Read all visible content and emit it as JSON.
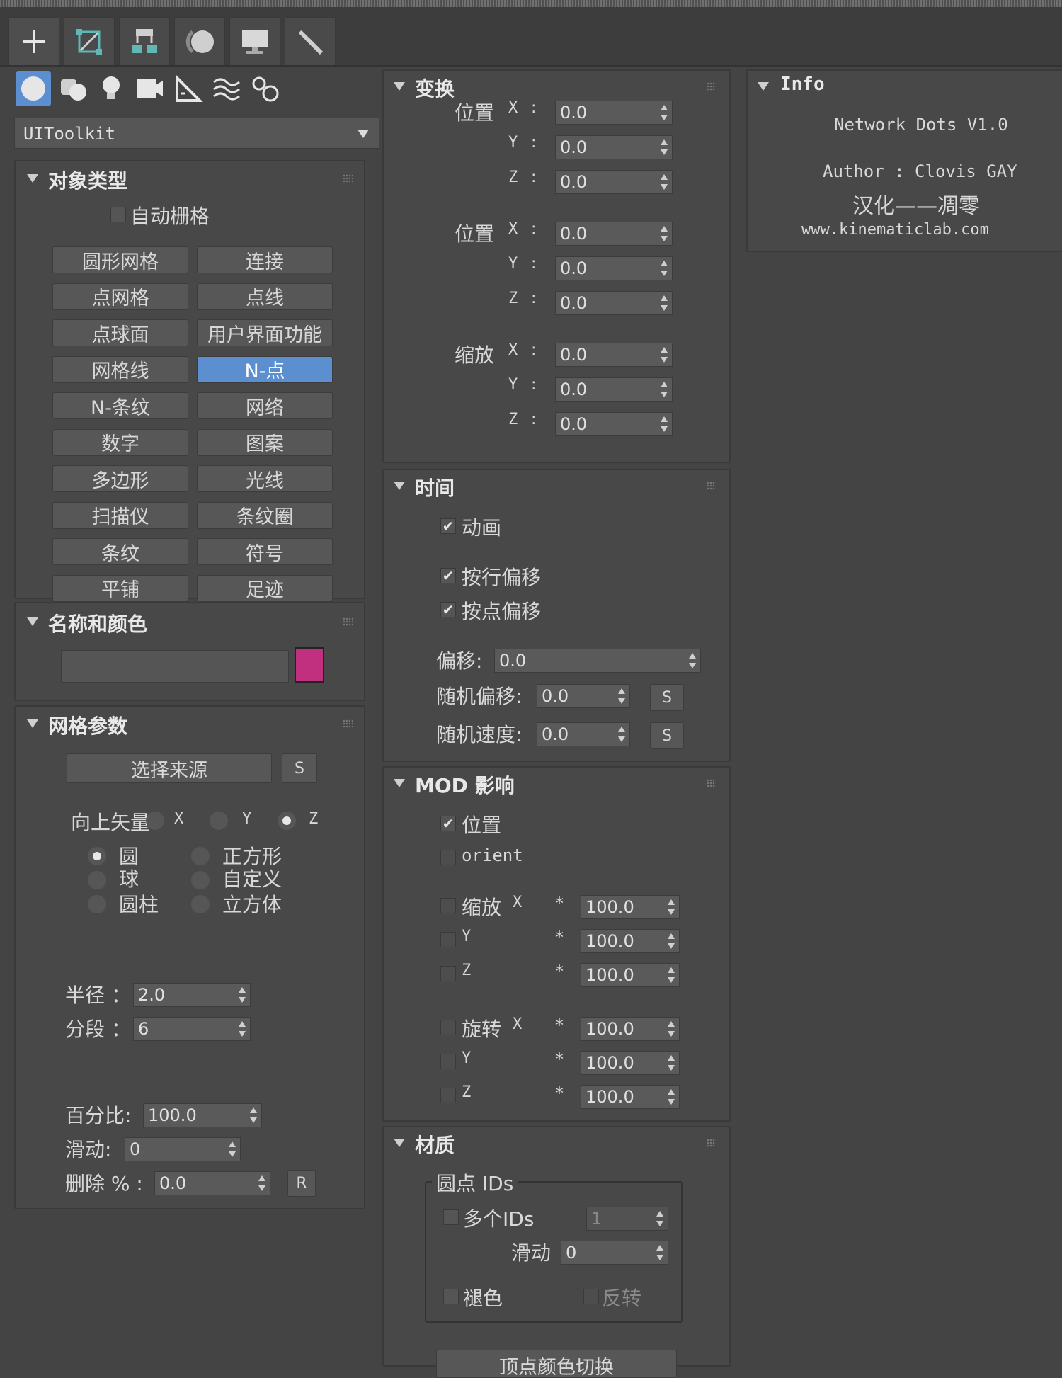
{
  "tabs": [
    "create-icon",
    "modify-icon",
    "hierarchy-icon",
    "motion-icon",
    "display-icon",
    "utilities-icon"
  ],
  "category_icons": [
    "geometry-icon",
    "shapes-icon",
    "lights-icon",
    "cameras-icon",
    "helpers-icon",
    "spacewarps-icon",
    "systems-icon"
  ],
  "dropdown": {
    "value": "UIToolkit"
  },
  "object_type": {
    "title": "对象类型",
    "autogrid": "自动栅格",
    "buttons": [
      "圆形网格",
      "连接",
      "点网格",
      "点线",
      "点球面",
      "用户界面功能",
      "网格线",
      "N-点",
      "N-条纹",
      "网络",
      "数字",
      "图案",
      "多边形",
      "光线",
      "扫描仪",
      "条纹圈",
      "条纹",
      "符号",
      "平铺",
      "足迹"
    ],
    "selected": "N-点"
  },
  "name_color": {
    "title": "名称和颜色",
    "name_value": "",
    "color": "#c0307f"
  },
  "grid_params": {
    "title": "网格参数",
    "select_source": "选择来源",
    "s_btn": "S",
    "up_vector": "向上矢量",
    "axes": [
      "X",
      "Y",
      "Z"
    ],
    "shapes_left": [
      "圆",
      "球",
      "圆柱"
    ],
    "shapes_right": [
      "正方形",
      "自定义",
      "立方体"
    ],
    "radius_label": "半径 ：",
    "radius_value": "2.0",
    "segments_label": "分段 ：",
    "segments_value": "6",
    "percent_label": "百分比:",
    "percent_value": "100.0",
    "slide_label": "滑动:",
    "slide_value": "0",
    "delete_label": "删除 % :",
    "delete_value": "0.0",
    "r_btn": "R"
  },
  "transform": {
    "title": "变换",
    "groups": [
      {
        "label": "位置",
        "rows": [
          {
            "axis": "X",
            "value": "0.0"
          },
          {
            "axis": "Y",
            "value": "0.0"
          },
          {
            "axis": "Z",
            "value": "0.0"
          }
        ]
      },
      {
        "label": "位置",
        "rows": [
          {
            "axis": "X",
            "value": "0.0"
          },
          {
            "axis": "Y",
            "value": "0.0"
          },
          {
            "axis": "Z",
            "value": "0.0"
          }
        ]
      },
      {
        "label": "缩放",
        "rows": [
          {
            "axis": "X",
            "value": "0.0"
          },
          {
            "axis": "Y",
            "value": "0.0"
          },
          {
            "axis": "Z",
            "value": "0.0"
          }
        ]
      }
    ],
    "colon": ":"
  },
  "time": {
    "title": "时间",
    "animation": "动画",
    "row_offset": "按行偏移",
    "point_offset": "按点偏移",
    "offset_label": "偏移:",
    "offset_value": "0.0",
    "rand_offset_label": "随机偏移:",
    "rand_offset_value": "0.0",
    "rand_speed_label": "随机速度:",
    "rand_speed_value": "0.0",
    "s_btn": "S"
  },
  "mod": {
    "title": "MOD 影响",
    "position": "位置",
    "orient": "orient",
    "scale_label": "缩放",
    "rotate_label": "旋转",
    "axes": [
      "X",
      "Y",
      "Z"
    ],
    "star": "*",
    "values": [
      "100.0",
      "100.0",
      "100.0",
      "100.0",
      "100.0",
      "100.0"
    ]
  },
  "material": {
    "title": "材质",
    "group_label": "圆点 IDs",
    "multi_ids": "多个IDs",
    "multi_ids_value": "1",
    "slide_label": "滑动",
    "slide_value": "0",
    "fade": "褪色",
    "invert": "反转",
    "bottom_btn": "顶点颜色切换"
  },
  "info": {
    "title": "Info",
    "line1": "Network Dots V1.0",
    "line2": "Author : Clovis GAY",
    "line3": "汉化——凋零",
    "line4": "www.kinematiclab.com"
  }
}
